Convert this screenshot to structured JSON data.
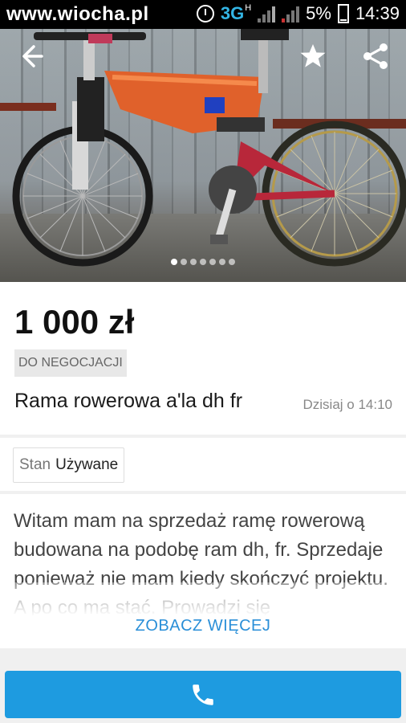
{
  "status_bar": {
    "watermark": "www.wiocha.pl",
    "network": "3G",
    "network_sub": "H",
    "battery": "5%",
    "time": "14:39"
  },
  "gallery": {
    "photo_count": 7,
    "active_index": 0
  },
  "ad": {
    "price": "1 000 zł",
    "negotiable_badge": "DO NEGOCJACJI",
    "title": "Rama rowerowa a'la dh fr",
    "date": "Dzisiaj o 14:10"
  },
  "params": {
    "condition_label": "Stan",
    "condition_value": "Używane"
  },
  "description": {
    "text": "Witam mam na sprzedaż ramę rowerową budowana na podobę ram dh, fr. Sprzedaje ponieważ nie mam kiedy skończyć projektu. A po co ma stać. Prowadzi się",
    "more_label": "ZOBACZ WIĘCEJ"
  },
  "icons": {
    "back": "arrow-left-icon",
    "favorite": "star-icon",
    "share": "share-icon",
    "call": "phone-icon"
  },
  "colors": {
    "accent": "#1e9be0",
    "link": "#2a8fd8",
    "status_bar": "#000000",
    "network": "#33b5e5"
  }
}
